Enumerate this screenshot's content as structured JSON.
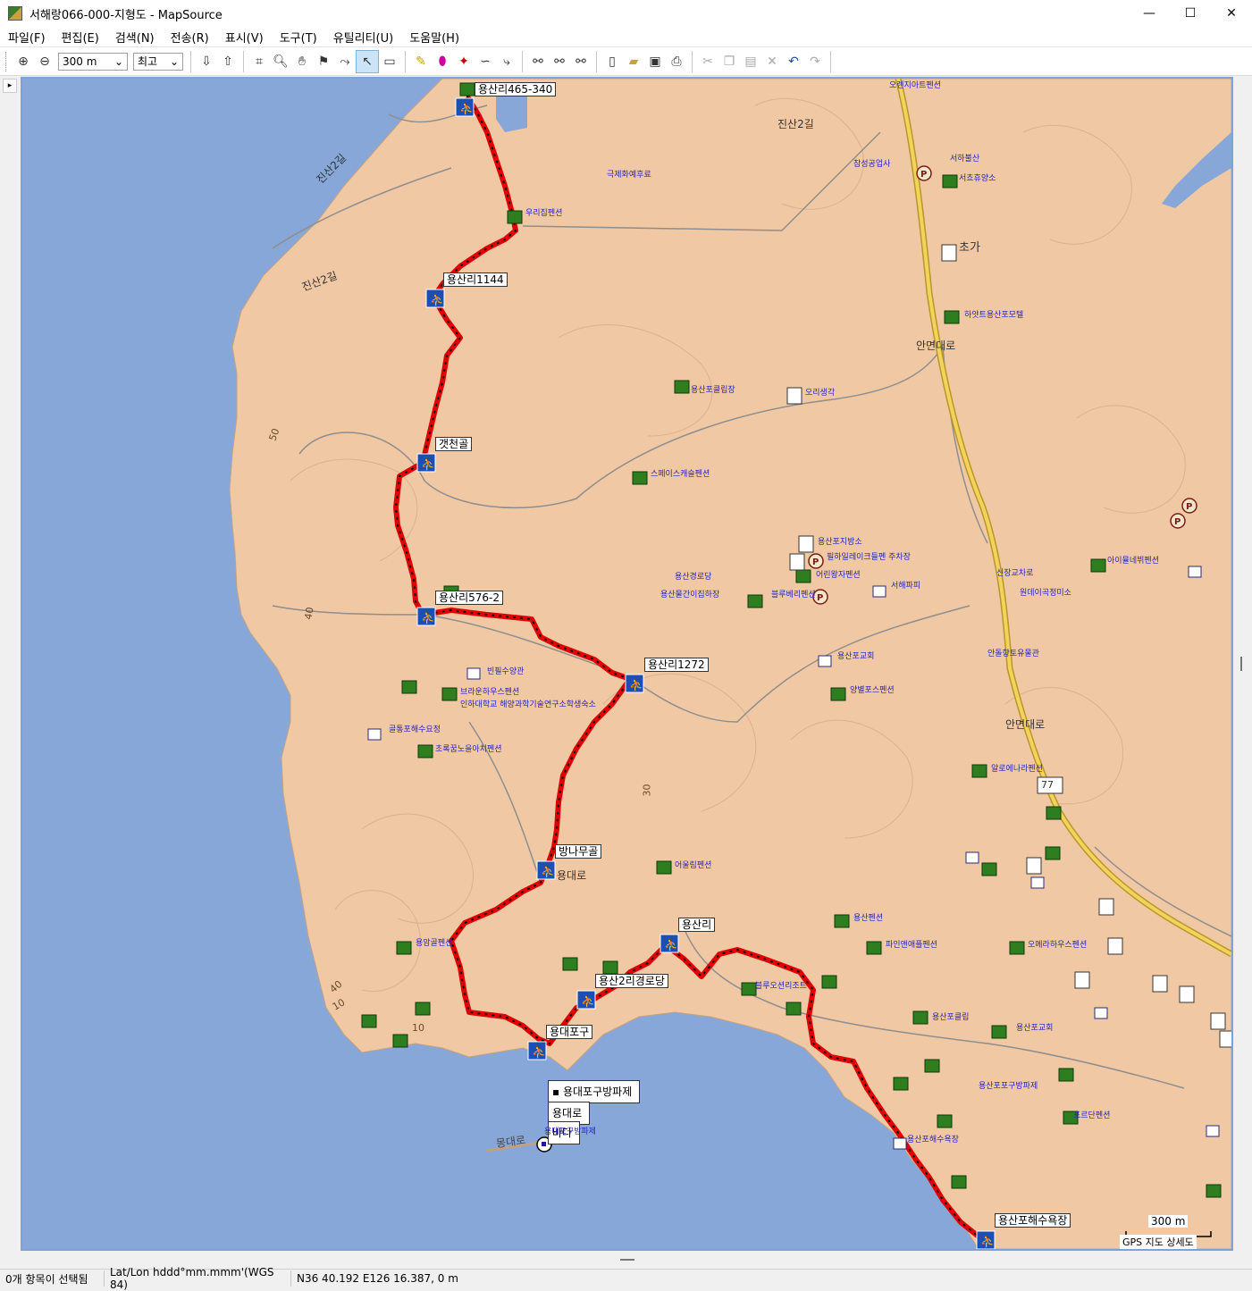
{
  "window": {
    "title": "서해랑066-000-지형도 - MapSource",
    "controls": [
      "—",
      "☐",
      "✕"
    ]
  },
  "menu": [
    "파일(F)",
    "편집(E)",
    "검색(N)",
    "전송(R)",
    "표시(V)",
    "도구(T)",
    "유틸리티(U)",
    "도움말(H)"
  ],
  "toolbar": {
    "zoom_value": "300 m",
    "detail_value": "최고",
    "icons": [
      "zoom-in",
      "zoom-out",
      "receive-from-device",
      "send-to-device",
      "map-tool",
      "zoom-tool",
      "pan-tool",
      "waypoint-tool",
      "route-tool",
      "select-tool",
      "measure-tool",
      "map-select",
      "erase",
      "track-tool",
      "route-divide",
      "route-insert",
      "find-places",
      "find-nearest",
      "find-address",
      "new",
      "open",
      "save",
      "print",
      "cut",
      "copy",
      "paste",
      "delete",
      "undo",
      "redo"
    ]
  },
  "map": {
    "colors": {
      "sea": "#86a7d7",
      "land": "#f0c8a4",
      "track": "#e10000",
      "highway": "#f4d35a",
      "poi": "#2626b8"
    },
    "track_labels": [
      "용산리465-340",
      "용산리1144",
      "갯천골",
      "용산리576-2",
      "용산리1272",
      "방나무골",
      "용산리",
      "용산2리경로당",
      "용대포구",
      "용산포해수욕장"
    ],
    "box_labels": [
      "용대포구방파제",
      "용대로",
      "바다"
    ],
    "road_labels": [
      "진산2길",
      "진산2길",
      "진산2길",
      "안면대로",
      "안면대로",
      "용대로",
      "77",
      "50",
      "40",
      "40",
      "30",
      "10",
      "10",
      "몽대로",
      "초가"
    ],
    "poi_labels": [
      "오렌지아트펜션",
      "극제화예후료",
      "우리집펜션",
      "서하불산",
      "서쵸휴양소",
      "참성공업사",
      "하얏트용산포모텔",
      "용산포클립장",
      "오리생각",
      "스페이스캐슬펜션",
      "용산포지방소",
      "필하일레이크들펜 주차장",
      "어린왕자펜션",
      "용산경로당",
      "용산물간이집하장",
      "블루베리펜션",
      "서해파피",
      "신장교차로",
      "원데이곡정미소",
      "용산포교회",
      "양별포스펜션",
      "안돌향토유물관",
      "아이뮬네뷔펜션",
      "빈필수양관",
      "브라운하우스펜션",
      "인하대학교 해양과학기술연구소학생숙소",
      "골통포해수요정",
      "초록꿈노을아치펜션",
      "알로에나라펜션",
      "어울림펜션",
      "용산펜션",
      "파인앤애플펜션",
      "오메라하우스펜션",
      "블루오션리조트",
      "용산포클립",
      "용암골펜션",
      "용대포구방파제",
      "용산포해수욕장",
      "포르단펜션",
      "용산포포구방파제",
      "용산포교회"
    ],
    "scale": {
      "distance": "300 m",
      "label": "GPS 지도 상세도"
    }
  },
  "status": {
    "selection": "0개 항목이 선택됨",
    "format": "Lat/Lon hddd°mm.mmm'(WGS 84)",
    "position": "N36 40.192 E126 16.387, 0 m"
  }
}
